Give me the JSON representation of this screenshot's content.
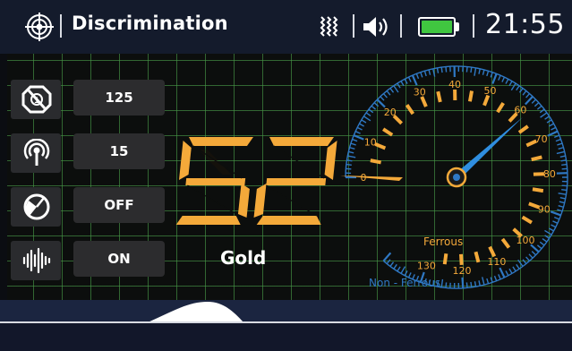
{
  "header": {
    "title": "Discrimination",
    "time": "21:55",
    "battery_level": 1.0,
    "icons": [
      "target-icon",
      "vibration-icon",
      "volume-icon",
      "battery-icon"
    ]
  },
  "settings": [
    {
      "name": "sensitivity",
      "icon": "sensitivity-icon",
      "value": "125"
    },
    {
      "name": "frequency",
      "icon": "signal-icon",
      "value": "15"
    },
    {
      "name": "ground-balance",
      "icon": "ground-balance-icon",
      "value": "OFF"
    },
    {
      "name": "audio",
      "icon": "audio-wave-icon",
      "value": "ON"
    }
  ],
  "detection": {
    "target_id": "52",
    "metal_type": "Gold"
  },
  "gauge": {
    "scale_labels": [
      "0",
      "10",
      "20",
      "30",
      "40",
      "50",
      "60",
      "70",
      "80",
      "90",
      "100",
      "110",
      "120",
      "130"
    ],
    "ferrous_label": "Ferrous",
    "non_ferrous_label": "Non - Ferrous",
    "needle_value": 62,
    "colors": {
      "scale": "#2f78c4",
      "labels": "#f4a93a",
      "needle": "#2f8ee0"
    }
  },
  "colors": {
    "accent": "#f4a93a",
    "grid": "#469646",
    "battery": "#40c640",
    "header": "#141b2c"
  }
}
